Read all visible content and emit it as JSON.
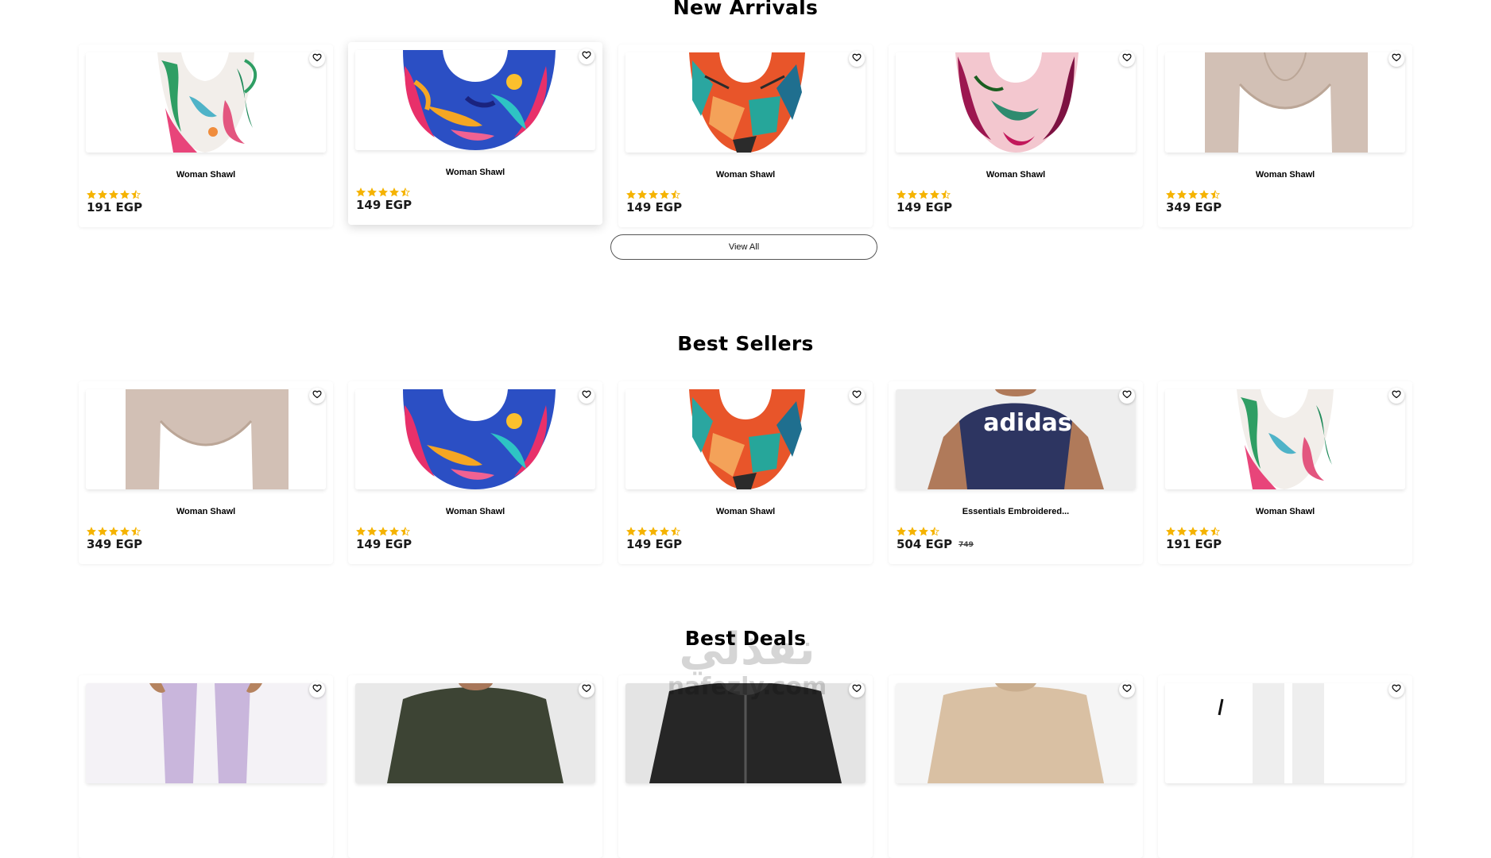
{
  "sections": [
    {
      "title": "New Arrivals",
      "products": [
        {
          "name": "Woman Shawl",
          "price": "191 EGP",
          "rating": 4.5,
          "image": "floral-white-shawl"
        },
        {
          "name": "Woman Shawl",
          "price": "149 EGP",
          "rating": 4.5,
          "image": "colorful-abstract-shawl"
        },
        {
          "name": "Woman Shawl",
          "price": "149 EGP",
          "rating": 4.5,
          "image": "geometric-orange-shawl"
        },
        {
          "name": "Woman Shawl",
          "price": "149 EGP",
          "rating": 4.5,
          "image": "magenta-leaf-shawl"
        },
        {
          "name": "Woman Shawl",
          "price": "349 EGP",
          "rating": 4.5,
          "image": "beige-scarf"
        }
      ],
      "view_all_label": "View All"
    },
    {
      "title": "Best Sellers",
      "products": [
        {
          "name": "Woman Shawl",
          "price": "349 EGP",
          "rating": 4.5,
          "image": "beige-scarf"
        },
        {
          "name": "Woman Shawl",
          "price": "149 EGP",
          "rating": 4.5,
          "image": "colorful-abstract-shawl"
        },
        {
          "name": "Woman Shawl",
          "price": "149 EGP",
          "rating": 4.5,
          "image": "geometric-orange-shawl"
        },
        {
          "name": "Essentials Embroidered...",
          "price": "504 EGP",
          "old_price": "749",
          "rating": 3.5,
          "image": "adidas-tshirt",
          "image_text": "adidas"
        },
        {
          "name": "Woman Shawl",
          "price": "191 EGP",
          "rating": 4.5,
          "image": "floral-white-shawl"
        }
      ]
    },
    {
      "title": "Best Deals",
      "products": [
        {
          "image": "lavender-pants"
        },
        {
          "image": "olive-tshirt"
        },
        {
          "image": "black-jacket"
        },
        {
          "image": "tan-sweater"
        },
        {
          "image": "white-socks"
        }
      ]
    }
  ],
  "watermark": {
    "arabic": "نفذلي",
    "latin": "nafezly.com"
  },
  "colors": {
    "star": "#f5b301",
    "heading": "#000000",
    "price": "#1a1a1a"
  },
  "icons": {
    "favorite": "heart-outline-icon",
    "rating": "star-icon"
  }
}
